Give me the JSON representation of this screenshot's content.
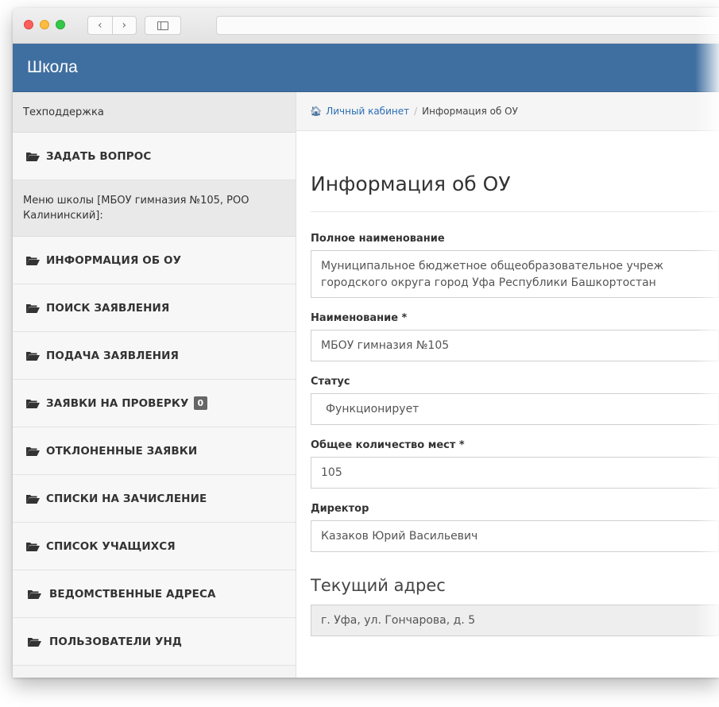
{
  "app": {
    "brand": "Школа"
  },
  "sidebar": {
    "support_header": "Техподдержка",
    "ask_question": "ЗАДАТЬ ВОПРОС",
    "school_menu_header": "Меню школы [МБОУ гимназия №105, РОО Калининский]:",
    "items": [
      {
        "label": "ИНФОРМАЦИЯ ОБ ОУ"
      },
      {
        "label": "ПОИСК ЗАЯВЛЕНИЯ"
      },
      {
        "label": "ПОДАЧА ЗАЯВЛЕНИЯ"
      },
      {
        "label": "ЗАЯВКИ НА ПРОВЕРКУ",
        "badge": "0"
      },
      {
        "label": "ОТКЛОНЕННЫЕ ЗАЯВКИ"
      },
      {
        "label": "СПИСКИ НА ЗАЧИСЛЕНИЕ"
      },
      {
        "label": "СПИСОК УЧАЩИХСЯ"
      },
      {
        "label": "ВЕДОМСТВЕННЫЕ АДРЕСА"
      },
      {
        "label": "ПОЛЬЗОВАТЕЛИ УНД"
      }
    ]
  },
  "breadcrumb": {
    "home": "Личный кабинет",
    "current": "Информация об ОУ"
  },
  "page": {
    "title": "Информация об ОУ",
    "full_name_label": "Полное наименование",
    "full_name_value": "Муниципальное бюджетное общеобразовательное учреж городского округа город Уфа Республики Башкортостан",
    "name_label": "Наименование *",
    "name_value": "МБОУ гимназия №105",
    "status_label": "Статус",
    "status_value": "Функционирует",
    "seats_label": "Общее количество мест *",
    "seats_value": "105",
    "director_label": "Директор",
    "director_value": "Казаков Юрий Васильевич",
    "address_title": "Текущий адрес",
    "address_value": "г. Уфа, ул. Гончарова, д. 5"
  }
}
